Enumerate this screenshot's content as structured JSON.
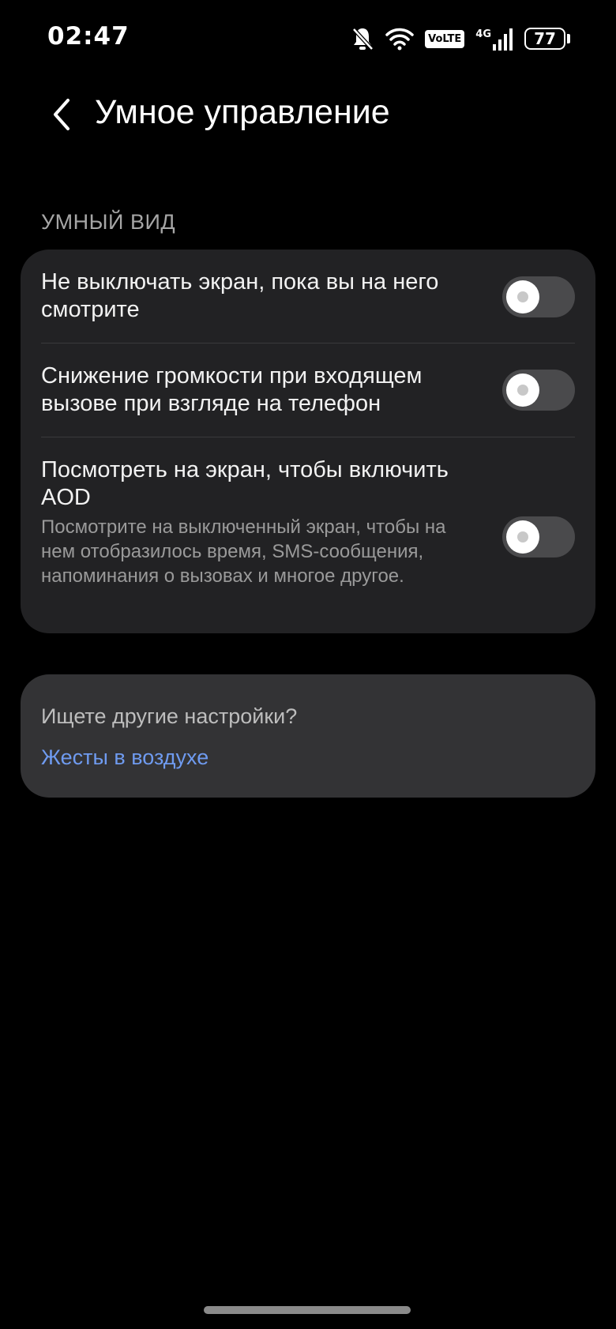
{
  "status_bar": {
    "time": "02:47",
    "volte_label": "VoLTE",
    "network_label": "4G",
    "battery_level": "77",
    "icons": [
      "bell-muted-icon",
      "wifi-icon",
      "volte-icon",
      "signal-icon",
      "battery-icon"
    ]
  },
  "header": {
    "back_icon": "chevron-left-icon",
    "title": "Умное управление"
  },
  "section": {
    "title": "УМНЫЙ ВИД",
    "settings": [
      {
        "title": "Не выключать экран, пока вы на него смотрите",
        "description": "",
        "enabled": false
      },
      {
        "title": "Снижение громкости при входящем вызове при взгляде на телефон",
        "description": "",
        "enabled": false
      },
      {
        "title": "Посмотреть на экран, чтобы включить AOD",
        "description": "Посмотрите на выключенный экран, чтобы на нем отобразилось время, SMS-сообщения, напоминания о вызовах и многое другое.",
        "enabled": false
      }
    ]
  },
  "other": {
    "label": "Ищете другие настройки?",
    "link": "Жесты в воздухе"
  },
  "colors": {
    "background": "#000000",
    "card": "#222224",
    "card_secondary": "#333335",
    "link": "#6f9bf0",
    "toggle_off": "#4a4a4c"
  }
}
